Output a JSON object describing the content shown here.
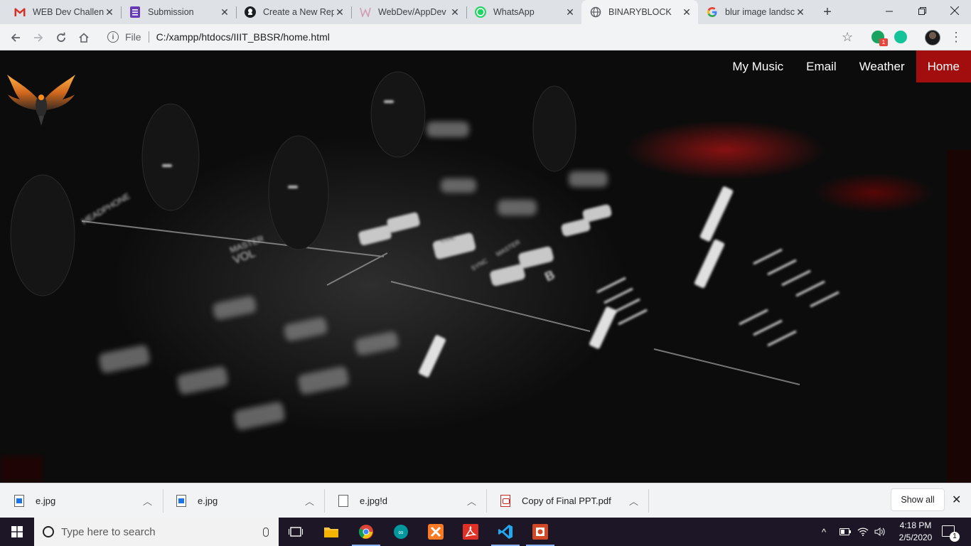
{
  "browser": {
    "tabs": [
      {
        "title": "WEB Dev Challeng",
        "icon": "gmail-icon",
        "active": false
      },
      {
        "title": "Submission",
        "icon": "forms-icon",
        "active": false
      },
      {
        "title": "Create a New Repo",
        "icon": "github-icon",
        "active": false
      },
      {
        "title": "WebDev/AppDev E",
        "icon": "web-icon",
        "active": false
      },
      {
        "title": "WhatsApp",
        "icon": "whatsapp-icon",
        "active": false
      },
      {
        "title": "BINARYBLOCK",
        "icon": "globe-icon",
        "active": true
      },
      {
        "title": "blur image landsca",
        "icon": "google-icon",
        "active": false
      }
    ],
    "new_tab_label": "+",
    "address": {
      "scheme_label": "File",
      "url": "C:/xampp/htdocs/IIIT_BBSR/home.html"
    },
    "extension_badge": "1"
  },
  "page": {
    "nav": [
      {
        "label": "My Music",
        "active": false
      },
      {
        "label": "Email",
        "active": false
      },
      {
        "label": "Weather",
        "active": false
      },
      {
        "label": "Home",
        "active": true
      }
    ],
    "accent_color": "#a20d0d"
  },
  "downloads": {
    "items": [
      {
        "name": "e.jpg",
        "icon": "image-file-icon"
      },
      {
        "name": "e.jpg",
        "icon": "image-file-icon"
      },
      {
        "name": "e.jpg!d",
        "icon": "file-icon"
      },
      {
        "name": "Copy of Final PPT.pdf",
        "icon": "pdf-file-icon"
      }
    ],
    "show_all_label": "Show all"
  },
  "taskbar": {
    "search_placeholder": "Type here to search",
    "time": "4:18 PM",
    "date": "2/5/2020",
    "notification_count": "1"
  }
}
